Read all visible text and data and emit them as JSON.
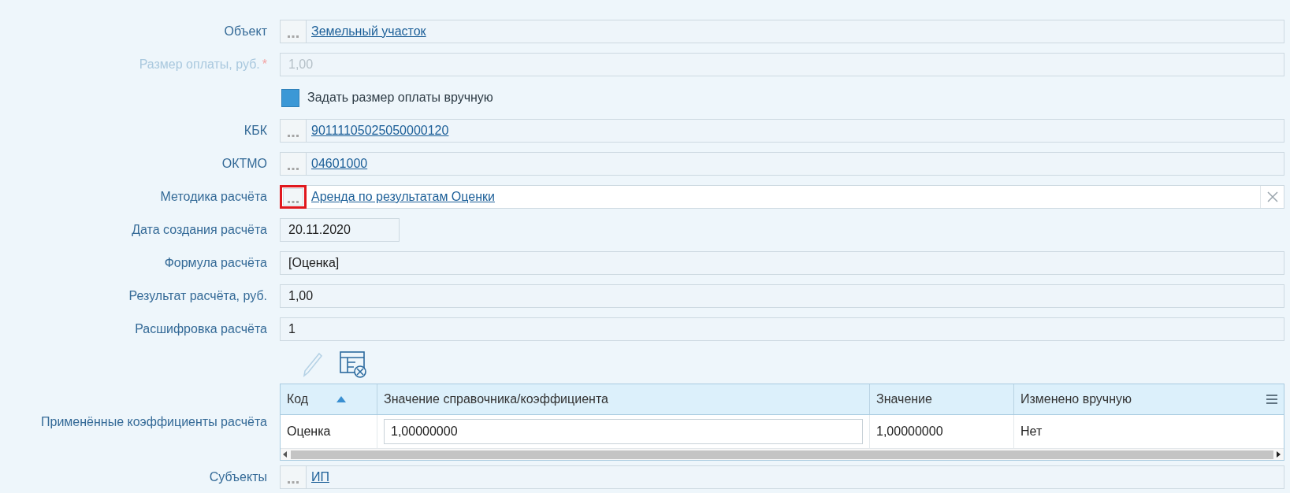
{
  "rows": [
    {
      "kind": "lookup",
      "label": "Объект",
      "value": "Земельный участок",
      "editable": false,
      "highlighted": false
    },
    {
      "kind": "text",
      "label": "Размер оплаты, руб.",
      "required_mark": "*",
      "value": "1,00",
      "disabled": true,
      "short": false
    },
    {
      "kind": "checkbox",
      "label": "Задать размер оплаты вручную",
      "checked": true
    },
    {
      "kind": "lookup",
      "label": "КБК",
      "value": "90111105025050000120",
      "editable": false,
      "highlighted": false
    },
    {
      "kind": "lookup",
      "label": "ОКТМО",
      "value": "04601000",
      "editable": false,
      "highlighted": false
    },
    {
      "kind": "lookup",
      "label": "Методика расчёта",
      "value": "Аренда по результатам Оценки",
      "editable": true,
      "highlighted": true
    },
    {
      "kind": "text",
      "label": "Дата создания расчёта",
      "value": "20.11.2020",
      "disabled": false,
      "short": true
    },
    {
      "kind": "text",
      "label": "Формула расчёта",
      "value": "[Оценка]",
      "disabled": false,
      "short": false
    },
    {
      "kind": "text",
      "label": "Результат расчёта, руб.",
      "value": "1,00",
      "disabled": false,
      "short": false
    },
    {
      "kind": "text",
      "label": "Расшифровка расчёта",
      "value": "1",
      "disabled": false,
      "short": false
    },
    {
      "kind": "table",
      "label": "Применённые коэффициенты расчёта",
      "edit_disabled": true,
      "columns": [
        {
          "title": "Код",
          "sorted": true
        },
        {
          "title": "Значение справочника/коэффициента",
          "sorted": false
        },
        {
          "title": "Значение",
          "sorted": false
        },
        {
          "title": "Изменено вручную",
          "sorted": false
        }
      ],
      "rows": [
        {
          "cells": [
            "Оценка",
            "1,00000000",
            "1,00000000",
            "Нет"
          ]
        }
      ]
    },
    {
      "kind": "lookup",
      "label": "Субъекты",
      "value": "ИП",
      "editable": false,
      "highlighted": false
    }
  ]
}
